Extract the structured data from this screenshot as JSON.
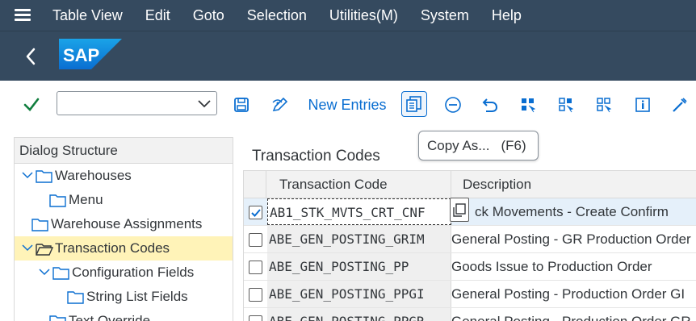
{
  "menubar": {
    "items": [
      "Table View",
      "Edit",
      "Goto",
      "Selection",
      "Utilities(M)",
      "System",
      "Help"
    ]
  },
  "shell": {
    "logo_text": "SAP"
  },
  "toolbar": {
    "command_value": "",
    "new_entries_label": "New Entries"
  },
  "tooltip": {
    "label": "Copy As...",
    "shortcut": "(F6)"
  },
  "dialog_structure": {
    "header": "Dialog Structure",
    "items": [
      {
        "label": "Warehouses",
        "level": 0,
        "expanded": true
      },
      {
        "label": "Menu",
        "level": 1,
        "expanded": false
      },
      {
        "label": "Warehouse Assignments",
        "level": 0,
        "expanded": false
      },
      {
        "label": "Transaction Codes",
        "level": 0,
        "expanded": true,
        "selected": true
      },
      {
        "label": "Configuration Fields",
        "level": 1,
        "expanded": true
      },
      {
        "label": "String List Fields",
        "level": 2,
        "expanded": false
      },
      {
        "label": "Text Override",
        "level": 1,
        "expanded": false
      }
    ]
  },
  "grid": {
    "title": "Transaction Codes",
    "columns": [
      "Transaction Code",
      "Description"
    ],
    "rows": [
      {
        "code": "AB1_STK_MVTS_CRT_CNF",
        "description": "ck Movements - Create Confirm",
        "checked": true
      },
      {
        "code": "ABE_GEN_POSTING_GRIM",
        "description": "General Posting - GR Production Order",
        "checked": false
      },
      {
        "code": "ABE_GEN_POSTING_PP",
        "description": "Goods Issue to Production Order",
        "checked": false
      },
      {
        "code": "ABE_GEN_POSTING_PPGI",
        "description": "General Posting - Production Order GI",
        "checked": false
      },
      {
        "code": "ABE_GEN_POSTING_PPGR",
        "description": "General Posting - Production Order GR",
        "checked": false
      }
    ]
  },
  "colors": {
    "shell": "#354a5f",
    "accent": "#0a6ed1",
    "selection": "#fff3b8",
    "ok_green": "#107e3e"
  }
}
